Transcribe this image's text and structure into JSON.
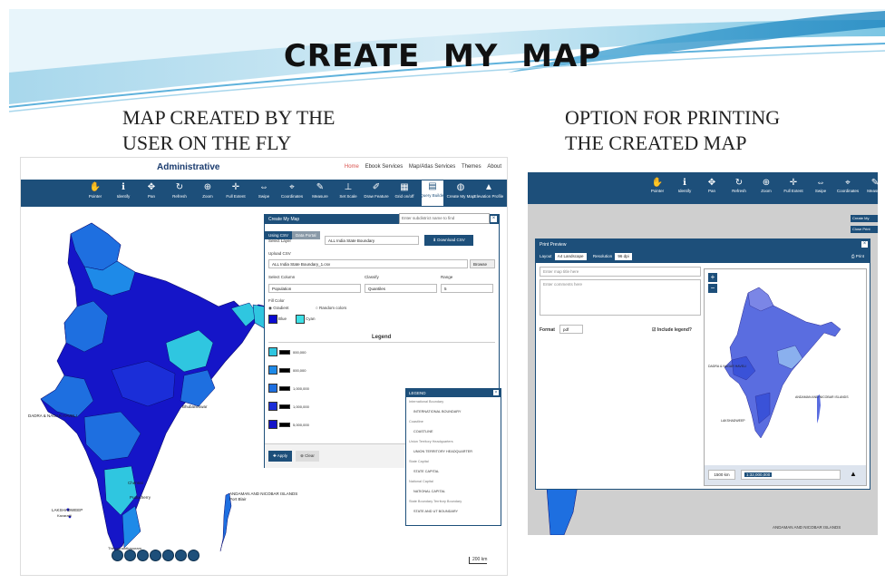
{
  "slide": {
    "title": "CREATE  MY  MAP",
    "caption_left": [
      "MAP CREATED BY THE",
      "USER ON THE FLY"
    ],
    "caption_right": [
      "OPTION  FOR PRINTING",
      "THE CREATED MAP"
    ]
  },
  "colors": {
    "toolbar": "#1d4f7a",
    "map_dark": "#1515c8",
    "map_mid": "#1e6fe0",
    "map_light": "#2fc6e0"
  },
  "shot1": {
    "app_title": "Administrative",
    "nav": [
      "Home",
      "Ebook Services",
      "Map/Atlas Services",
      "Themes",
      "About"
    ],
    "tools": [
      {
        "icon": "hand-icon",
        "glyph": "✋",
        "label": "Pointer"
      },
      {
        "icon": "info-icon",
        "glyph": "ℹ",
        "label": "Identify"
      },
      {
        "icon": "pan-icon",
        "glyph": "✥",
        "label": "Pan"
      },
      {
        "icon": "refresh-icon",
        "glyph": "↻",
        "label": "Refresh"
      },
      {
        "icon": "zoom-icon",
        "glyph": "⊕",
        "label": "Zoom"
      },
      {
        "icon": "full-extent-icon",
        "glyph": "✛",
        "label": "Full Extent"
      },
      {
        "icon": "swipe-icon",
        "glyph": "⇔",
        "label": "Swipe"
      },
      {
        "icon": "coordinates-icon",
        "glyph": "⌖",
        "label": "Coordinates"
      },
      {
        "icon": "measure-icon",
        "glyph": "✎",
        "label": "Measure"
      },
      {
        "icon": "set-scale-icon",
        "glyph": "⊥",
        "label": "Set Scale"
      },
      {
        "icon": "draw-feature-icon",
        "glyph": "✐",
        "label": "Draw Feature"
      },
      {
        "icon": "grid-icon",
        "glyph": "▦",
        "label": "Grid on/off"
      },
      {
        "icon": "query-icon",
        "glyph": "▤",
        "label": "Query Builder"
      },
      {
        "icon": "create-map-icon",
        "glyph": "◍",
        "label": "Create My Map"
      },
      {
        "icon": "elevation-icon",
        "glyph": "▲",
        "label": "Elevation Profile"
      }
    ],
    "panel": {
      "title": "Create My Map",
      "search_placeholder": "Enter subdistrict name to find",
      "tabs": [
        "Using CSV",
        "Data Portal"
      ],
      "select_layer_label": "Select Layer",
      "select_layer_value": "ALL India State Boundary",
      "download_btn": "Download CSV",
      "upload_label": "Upload CSV",
      "upload_value": "ALL India State Boundary_1.csv",
      "browse_btn": "Browse",
      "attribute_label": "Select Column",
      "attribute_value": "Population",
      "classify_label": "Classify",
      "classify_value": "Quantiles",
      "range_label": "Range",
      "range_value": "5",
      "fill_label": "Fill Color",
      "radio_gradient": "Gradient",
      "radio_random": "Random colors",
      "color_from": "Blue",
      "color_to": "Cyan",
      "legend_heading": "Legend",
      "legend_values": [
        "000,000",
        "000,000",
        "1,000,000",
        "1,000,000",
        "5,000,000"
      ],
      "apply_btn": "Apply",
      "clear_btn": "Clear"
    },
    "legend_panel": {
      "title": "LEGEND",
      "items": [
        {
          "text": "International Boundary",
          "sub": true
        },
        {
          "text": "INTERNATIONAL BOUNDARY",
          "sub": false
        },
        {
          "text": "Coastline",
          "sub": true
        },
        {
          "text": "COASTLINE",
          "sub": false
        },
        {
          "text": "Union Territory Headquarters",
          "sub": true
        },
        {
          "text": "UNION TERRITORY HEADQUARTER",
          "sub": false
        },
        {
          "text": "State Capital",
          "sub": true
        },
        {
          "text": "STATE CAPITAL",
          "sub": false
        },
        {
          "text": "National Capital",
          "sub": true
        },
        {
          "text": "NATIONAL CAPITAL",
          "sub": false
        },
        {
          "text": "State Boundary Territory Boundary",
          "sub": true
        },
        {
          "text": "STATE AND UT BOUNDARY",
          "sub": false
        }
      ]
    },
    "map_labels": {
      "west_coast": "DADRA & NAGAR HAVELI",
      "lakshadweep": "LAKSHADWEEP",
      "andaman": "ANDAMAN AND NICOBAR ISLANDS",
      "port_blair": "Port Blair",
      "chennai": "Chennai",
      "puducherry": "Puducherry",
      "bhubaneswar": "Bhubaneswar",
      "kavaratti": "Kavaratti",
      "thiruvananthapuram": "Thiruvananthapuram"
    },
    "scale": "200 km"
  },
  "shot2": {
    "tools": [
      {
        "icon": "hand-icon",
        "glyph": "✋",
        "label": "Pointer"
      },
      {
        "icon": "info-icon",
        "glyph": "ℹ",
        "label": "Identify"
      },
      {
        "icon": "pan-icon",
        "glyph": "✥",
        "label": "Pan"
      },
      {
        "icon": "refresh-icon",
        "glyph": "↻",
        "label": "Refresh"
      },
      {
        "icon": "zoom-icon",
        "glyph": "⊕",
        "label": "Zoom"
      },
      {
        "icon": "full-extent-icon",
        "glyph": "✛",
        "label": "Full Extent"
      },
      {
        "icon": "swipe-icon",
        "glyph": "⇔",
        "label": "Swipe"
      },
      {
        "icon": "coordinates-icon",
        "glyph": "⌖",
        "label": "Coordinates"
      },
      {
        "icon": "measure-icon",
        "glyph": "✎",
        "label": "Measure"
      }
    ],
    "panel": {
      "title": "Print Preview",
      "layout_label": "Layout",
      "layout_value": "A4 Landscape",
      "resolution_label": "Resolution",
      "resolution_value": "96 dpi",
      "print_btn": "Print",
      "title_placeholder": "Enter map title here",
      "comments_placeholder": "Enter comments here",
      "format_label": "Format",
      "format_value": "pdf",
      "include_legend": "Include legend?",
      "scale_value": "1500 km",
      "scale_input": "1:32,000,000"
    },
    "side_buttons": [
      "Create My",
      "Close Print"
    ],
    "map_labels": {
      "andaman": "ANDAMAN AND NICOBAR ISLANDS",
      "lakshadweep": "LAKSHADWEEP",
      "dadra": "DADRA & NAGAR HAVELI",
      "andaman_bottom": "ANDAMAN AND NICOBAR ISLANDS"
    }
  }
}
